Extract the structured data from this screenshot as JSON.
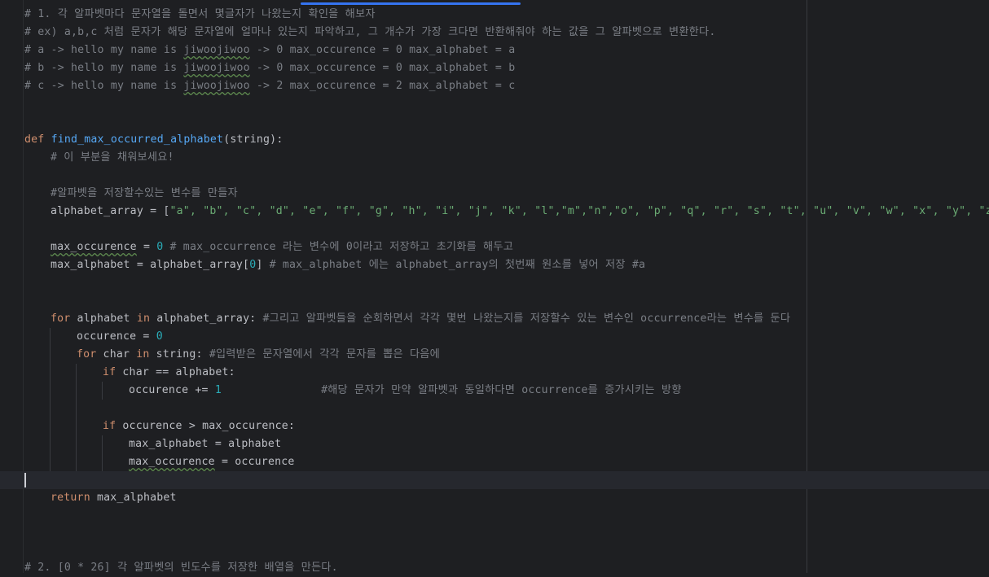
{
  "editor": {
    "lines": {
      "l1": "# 1. 각 알파벳마다 문자열을 돌면서 몇글자가 나왔는지 확인을 해보자",
      "l2": "# ex) a,b,c 처럼 문자가 해당 문자열에 얼마나 있는지 파악하고, 그 개수가 가장 크다면 반환해줘야 하는 값을 그 알파벳으로 변환한다.",
      "l3a": "# a -> hello my name is ",
      "l3b": "jiwoojiwoo",
      "l3c": " -> 0 max_occurence = 0 max_alphabet = a",
      "l4a": "# b -> hello my name is ",
      "l4b": "jiwoojiwoo",
      "l4c": " -> 0 max_occurence = 0 max_alphabet = b",
      "l5a": "# c -> hello my name is ",
      "l5b": "jiwoojiwoo",
      "l5c": " -> 2 max_occurence = 2 max_alphabet = c",
      "def_kw": "def",
      "def_name": "find_max_occurred_alphabet",
      "def_sig": "(string):",
      "c1": "# 이 부분을 채워보세요!",
      "c2": "#알파벳을 저장할수있는 변수를 만들자",
      "arr_lhs": "alphabet_array = [",
      "arr_items": "\"a\", \"b\", \"c\", \"d\", \"e\", \"f\", \"g\", \"h\", \"i\", \"j\", \"k\", \"l\",\"m\",\"n\",\"o\", \"p\", \"q\", \"r\", \"s\", \"t\", \"u\", \"v\", \"w\", \"x\", \"y\", \"z\"",
      "arr_end": "]",
      "mo_name": "max_occurence",
      "mo_eq": " = ",
      "mo_val": "0",
      "mo_cm": " # max_occurrence 라는 변수에 0이라고 저장하고 초기화를 해두고",
      "ma_lhs": "max_alphabet = alphabet_array[",
      "ma_idx": "0",
      "ma_rb": "]",
      "ma_cm": " # max_alphabet 에는 alphabet_array의 첫번째 원소를 넣어 저장 #a",
      "for_kw": "for",
      "for_var": " alphabet ",
      "in_kw": "in",
      "for_rest": " alphabet_array: ",
      "for_cm": "#그리고 알파벳들을 순회하면서 각각 몇번 나왔는지를 저장할수 있는 변수인 occurrence라는 변수를 둔다",
      "occ_lhs": "occurence = ",
      "occ_val": "0",
      "for2_kw": "for",
      "for2_var": " char ",
      "in2_kw": "in",
      "for2_rest": " string: ",
      "for2_cm": "#입력받은 문자열에서 각각 문자를 뽑은 다음에",
      "if1_kw": "if",
      "if1_rest": " char == alphabet:",
      "inc_lhs": "occurence += ",
      "inc_val": "1",
      "inc_pad": "               ",
      "inc_cm": "#해당 문자가 만약 알파벳과 동일하다면 occurrence를 증가시키는 방향",
      "if2_kw": "if",
      "if2_rest": " occurence > max_occurence:",
      "asg1": "max_alphabet = alphabet",
      "asg2_name": "max_occurence",
      "asg2_rest": " = occurence",
      "ret_kw": "return",
      "ret_rest": " max_alphabet",
      "last": "# 2. [0 * 26] 각 알파벳의 빈도수를 저장한 배열을 만든다."
    }
  }
}
